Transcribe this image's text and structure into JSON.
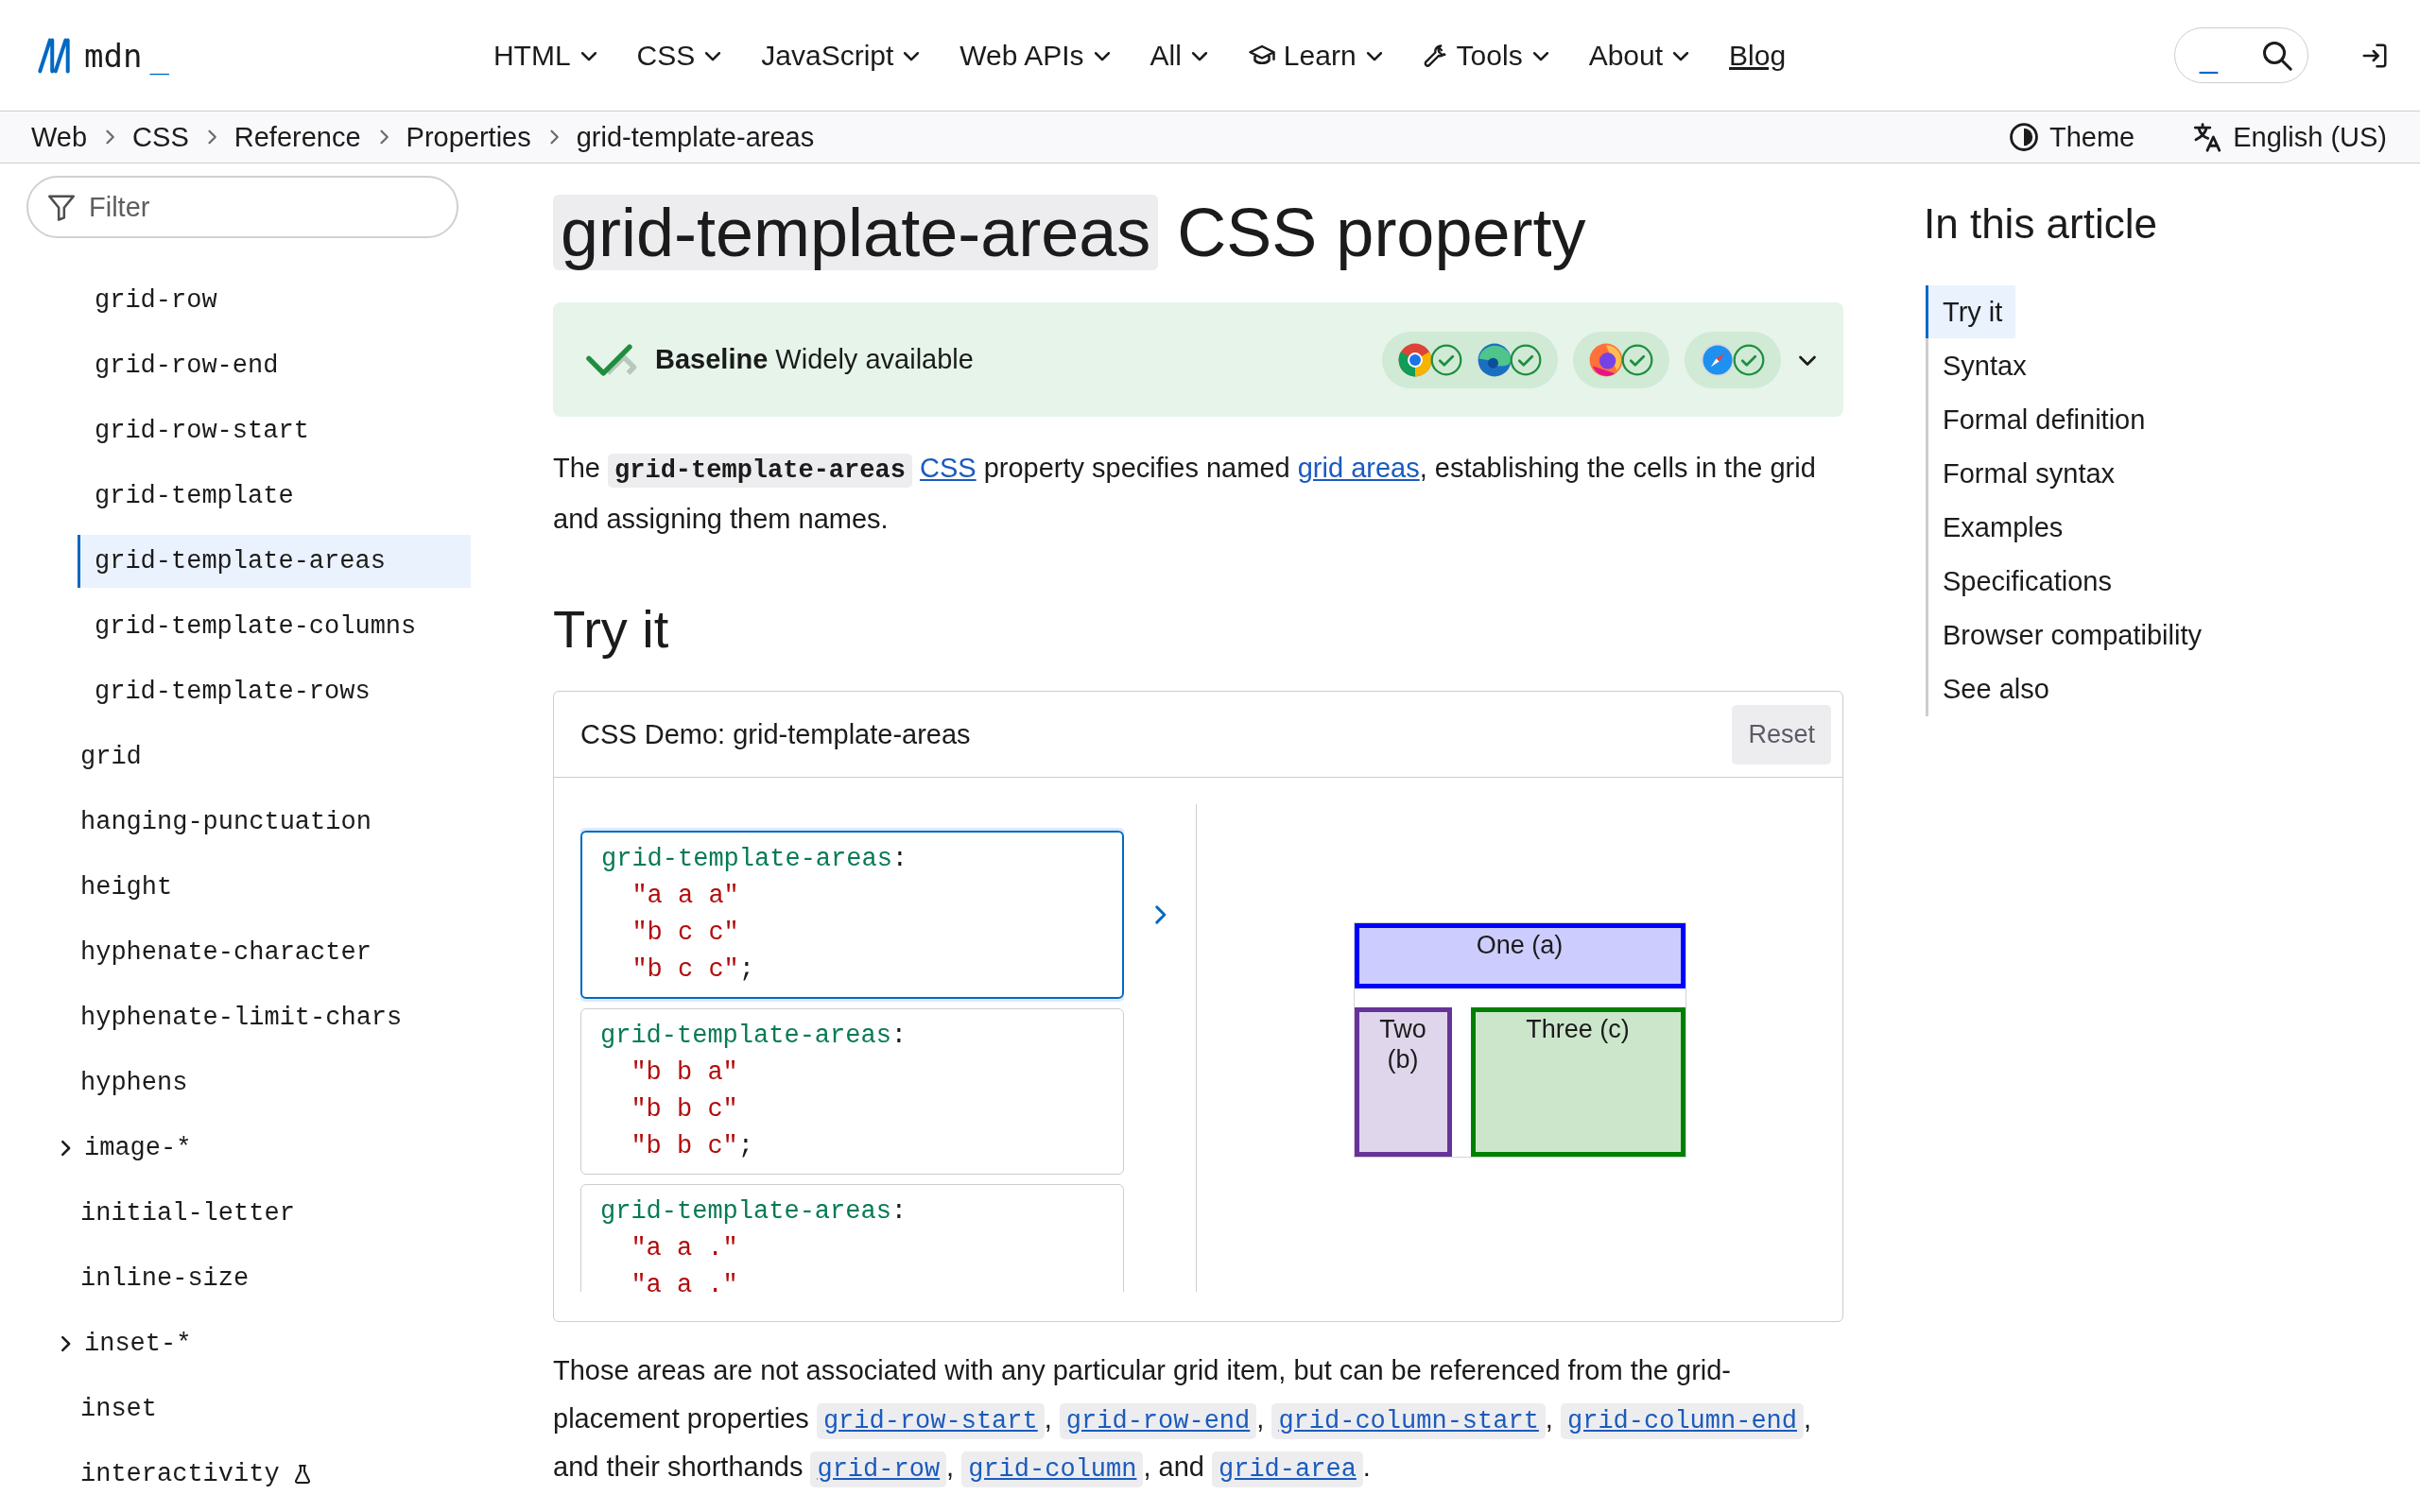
{
  "header": {
    "logo": {
      "name": "mdn",
      "cursor": "_"
    },
    "nav": [
      {
        "label": "HTML",
        "kind": "menu"
      },
      {
        "label": "CSS",
        "kind": "menu"
      },
      {
        "label": "JavaScript",
        "kind": "menu"
      },
      {
        "label": "Web APIs",
        "kind": "menu"
      },
      {
        "label": "All",
        "kind": "menu"
      },
      {
        "label": "Learn",
        "kind": "menu"
      },
      {
        "label": "Tools",
        "kind": "menu"
      },
      {
        "label": "About",
        "kind": "menu"
      },
      {
        "label": "Blog",
        "kind": "link"
      }
    ],
    "search": {
      "prompt": "_"
    }
  },
  "breadcrumbs": [
    "Web",
    "CSS",
    "Reference",
    "Properties",
    "grid-template-areas"
  ],
  "page_tools": {
    "theme": "Theme",
    "language": "English (US)"
  },
  "sidebar": {
    "filter": {
      "placeholder": "Filter"
    },
    "sub_items": [
      {
        "label": "grid-row",
        "selected": false
      },
      {
        "label": "grid-row-end",
        "selected": false
      },
      {
        "label": "grid-row-start",
        "selected": false
      },
      {
        "label": "grid-template",
        "selected": false
      },
      {
        "label": "grid-template-areas",
        "selected": true
      },
      {
        "label": "grid-template-columns",
        "selected": false
      },
      {
        "label": "grid-template-rows",
        "selected": false
      }
    ],
    "items": [
      {
        "label": "grid",
        "kind": "page",
        "selected": false,
        "experimental": false
      },
      {
        "label": "hanging-punctuation",
        "kind": "page",
        "selected": false,
        "experimental": false
      },
      {
        "label": "height",
        "kind": "page",
        "selected": false,
        "experimental": false
      },
      {
        "label": "hyphenate-character",
        "kind": "page",
        "selected": false,
        "experimental": false
      },
      {
        "label": "hyphenate-limit-chars",
        "kind": "page",
        "selected": false,
        "experimental": false
      },
      {
        "label": "hyphens",
        "kind": "page",
        "selected": false,
        "experimental": false
      },
      {
        "label": "image-*",
        "kind": "group",
        "expanded": false,
        "selected": false,
        "experimental": false
      },
      {
        "label": "initial-letter",
        "kind": "page",
        "selected": false,
        "experimental": false
      },
      {
        "label": "inline-size",
        "kind": "page",
        "selected": false,
        "experimental": false
      },
      {
        "label": "inset-*",
        "kind": "group",
        "expanded": false,
        "selected": false,
        "experimental": false
      },
      {
        "label": "inset",
        "kind": "page",
        "selected": false,
        "experimental": false
      },
      {
        "label": "interactivity",
        "kind": "page",
        "selected": false,
        "experimental": true
      }
    ]
  },
  "article": {
    "title": {
      "code": "grid-template-areas",
      "suffix": "CSS property"
    },
    "baseline": {
      "label": "Baseline",
      "status": "Widely available",
      "expanded": false
    },
    "intro": [
      {
        "kind": "text",
        "text": "The "
      },
      {
        "kind": "code",
        "text": "grid-template-areas",
        "space_after": true
      },
      {
        "kind": "link",
        "text": "CSS"
      },
      {
        "kind": "text",
        "text": " property specifies named "
      },
      {
        "kind": "link",
        "text": "grid areas"
      },
      {
        "kind": "text",
        "text": ", establishing the cells in the grid and assigning them names."
      }
    ],
    "try_it": {
      "heading": "Try it",
      "demo": {
        "title": "CSS Demo: grid-template-areas",
        "reset": "Reset",
        "options": [
          {
            "selected": true,
            "lines": [
              [
                {
                  "kind": "property",
                  "text": "grid-template-areas"
                },
                {
                  "kind": "punct",
                  "text": ":"
                }
              ],
              [
                {
                  "kind": "string",
                  "text": "\"a a a\""
                }
              ],
              [
                {
                  "kind": "string",
                  "text": "\"b c c\""
                }
              ],
              [
                {
                  "kind": "string",
                  "text": "\"b c c\""
                },
                {
                  "kind": "punct",
                  "text": ";"
                }
              ]
            ]
          },
          {
            "selected": false,
            "lines": [
              [
                {
                  "kind": "property",
                  "text": "grid-template-areas"
                },
                {
                  "kind": "punct",
                  "text": ":"
                }
              ],
              [
                {
                  "kind": "string",
                  "text": "\"b b a\""
                }
              ],
              [
                {
                  "kind": "string",
                  "text": "\"b b c\""
                }
              ],
              [
                {
                  "kind": "string",
                  "text": "\"b b c\""
                },
                {
                  "kind": "punct",
                  "text": ";"
                }
              ]
            ]
          },
          {
            "selected": false,
            "lines": [
              [
                {
                  "kind": "property",
                  "text": "grid-template-areas"
                },
                {
                  "kind": "punct",
                  "text": ":"
                }
              ],
              [
                {
                  "kind": "string",
                  "text": "\"a a .\""
                }
              ],
              [
                {
                  "kind": "string",
                  "text": "\"a a .\""
                }
              ]
            ]
          }
        ],
        "output": [
          {
            "label": "One (a)",
            "color": "#0000ff"
          },
          {
            "label": "Two (b)",
            "color": "#663399"
          },
          {
            "label": "Three (c)",
            "color": "#008000"
          }
        ]
      }
    },
    "note": [
      {
        "kind": "text",
        "text": "Those areas are not associated with any particular grid item, but can be referenced from the grid-placement properties "
      },
      {
        "kind": "codelink",
        "text": "grid-row-start"
      },
      {
        "kind": "text",
        "text": ", "
      },
      {
        "kind": "codelink",
        "text": "grid-row-end"
      },
      {
        "kind": "text",
        "text": ", "
      },
      {
        "kind": "codelink",
        "text": "grid-column-start"
      },
      {
        "kind": "text",
        "text": ", "
      },
      {
        "kind": "codelink",
        "text": "grid-column-end"
      },
      {
        "kind": "text",
        "text": ", and their shorthands "
      },
      {
        "kind": "codelink",
        "text": "grid-row"
      },
      {
        "kind": "text",
        "text": ", "
      },
      {
        "kind": "codelink",
        "text": "grid-column"
      },
      {
        "kind": "text",
        "text": ", and "
      },
      {
        "kind": "codelink",
        "text": "grid-area"
      },
      {
        "kind": "text",
        "text": "."
      }
    ]
  },
  "toc": {
    "title": "In this article",
    "items": [
      {
        "label": "Try it",
        "selected": true
      },
      {
        "label": "Syntax",
        "selected": false
      },
      {
        "label": "Formal definition",
        "selected": false
      },
      {
        "label": "Formal syntax",
        "selected": false
      },
      {
        "label": "Examples",
        "selected": false
      },
      {
        "label": "Specifications",
        "selected": false
      },
      {
        "label": "Browser compatibility",
        "selected": false
      },
      {
        "label": "See also",
        "selected": false
      }
    ]
  }
}
